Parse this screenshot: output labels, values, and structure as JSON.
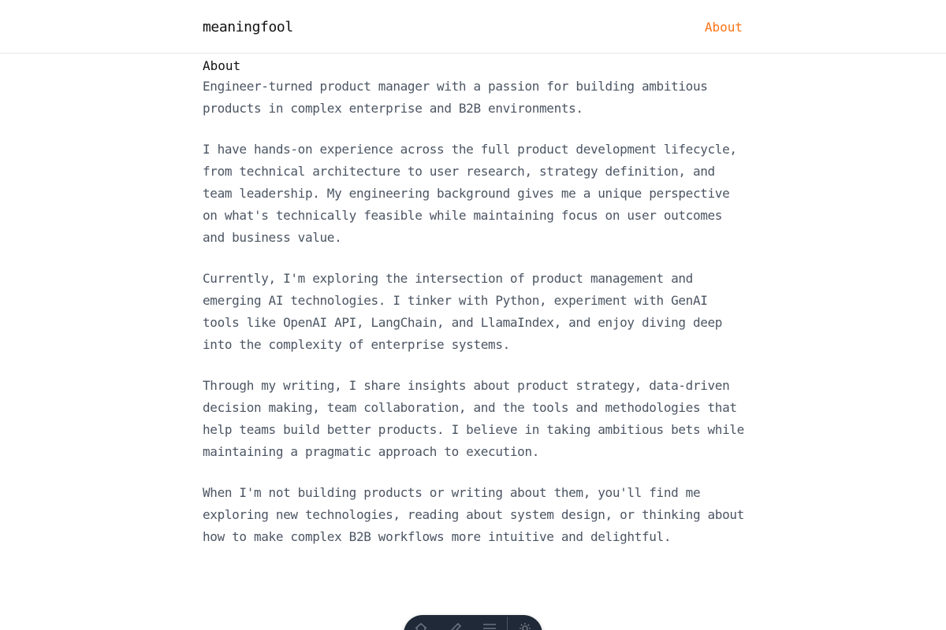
{
  "header": {
    "site_title": "meaningfool",
    "nav": {
      "about_label": "About"
    }
  },
  "colors": {
    "accent": "#f97316",
    "text": "#4b5563",
    "heading": "#111111",
    "dock_background": "#1f2937"
  },
  "main": {
    "title": "About",
    "paragraphs": [
      "Engineer-turned product manager with a passion for building ambitious products in complex enterprise and B2B environments.",
      "I have hands-on experience across the full product development lifecycle, from technical architecture to user research, strategy definition, and team leadership. My engineering background gives me a unique perspective on what's technically feasible while maintaining focus on user outcomes and business value.",
      "Currently, I'm exploring the intersection of product management and emerging AI technologies. I tinker with Python, experiment with GenAI tools like OpenAI API, LangChain, and LlamaIndex, and enjoy diving deep into the complexity of enterprise systems.",
      "Through my writing, I share insights about product strategy, data-driven decision making, team collaboration, and the tools and methodologies that help teams build better products. I believe in taking ambitious bets while maintaining a pragmatic approach to execution.",
      "When I'm not building products or writing about them, you'll find me exploring new technologies, reading about system design, or thinking about how to make complex B2B workflows more intuitive and delightful."
    ]
  },
  "dock": {
    "icons": [
      "home-icon",
      "write-icon",
      "menu-icon",
      "settings-icon"
    ]
  }
}
